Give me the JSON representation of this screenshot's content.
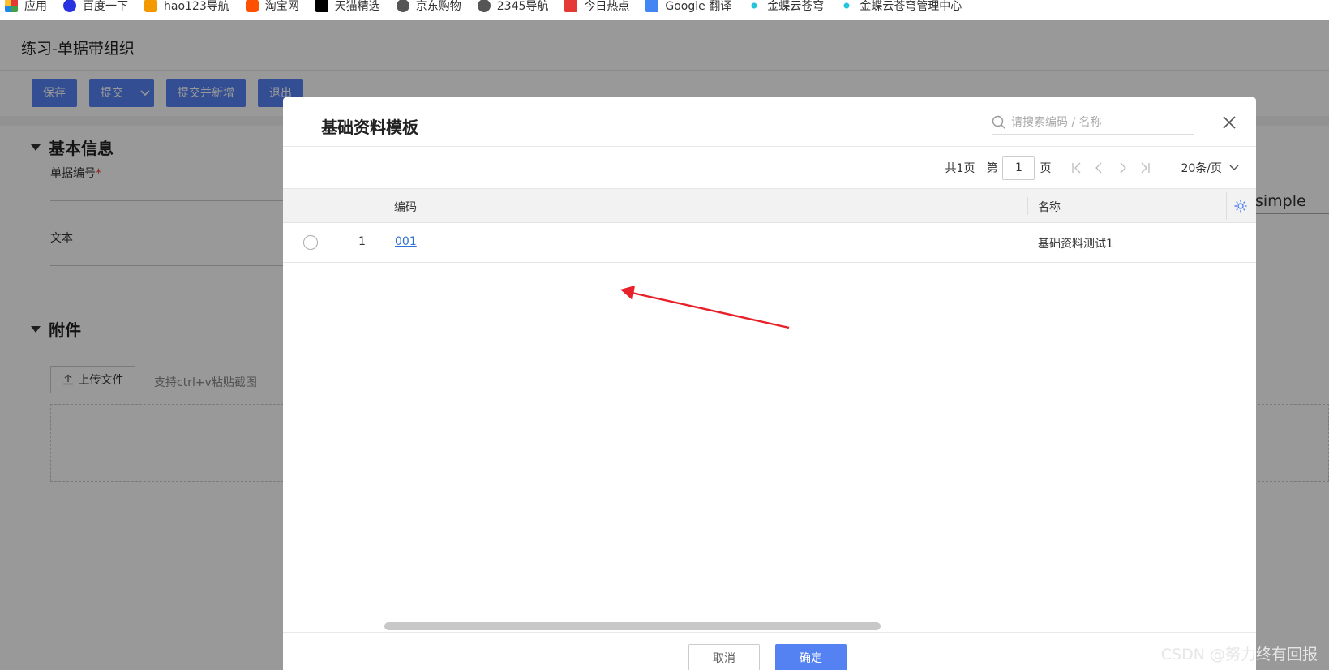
{
  "bookmarks": [
    {
      "label": "应用",
      "icon": "apps-icon"
    },
    {
      "label": "百度一下",
      "icon": "baidu-icon"
    },
    {
      "label": "hao123导航",
      "icon": "hao123-icon"
    },
    {
      "label": "淘宝网",
      "icon": "taobao-icon"
    },
    {
      "label": "天猫精选",
      "icon": "tmall-icon"
    },
    {
      "label": "京东购物",
      "icon": "globe-icon"
    },
    {
      "label": "2345导航",
      "icon": "globe-icon"
    },
    {
      "label": "今日热点",
      "icon": "toutiao-icon"
    },
    {
      "label": "Google 翻译",
      "icon": "google-translate-icon"
    },
    {
      "label": "金蝶云苍穹",
      "icon": "kingdee-icon"
    },
    {
      "label": "金蝶云苍穹管理中心",
      "icon": "kingdee-icon"
    }
  ],
  "app": {
    "title": "练习-单据带组织",
    "toolbar": {
      "save": "保存",
      "submit": "提交",
      "submit_new": "提交并新增",
      "exit": "退出"
    },
    "sections": {
      "basic_info": "基本信息",
      "attachment": "附件"
    },
    "fields": {
      "bill_no": "单据编号",
      "required_mark": "*",
      "text": "文本"
    },
    "upload": {
      "button": "上传文件",
      "hint": "支持ctrl+v粘贴截图"
    },
    "side_text": "simple"
  },
  "modal": {
    "title": "基础资料模板",
    "search_placeholder": "请搜索编码 / 名称",
    "pager": {
      "total": "共1页",
      "page_prefix": "第",
      "page_value": "1",
      "page_suffix": "页",
      "page_size": "20条/页"
    },
    "columns": {
      "code": "编码",
      "name": "名称"
    },
    "rows": [
      {
        "index": "1",
        "code": "001",
        "name": "基础资料测试1"
      }
    ],
    "cancel": "取消",
    "confirm": "确定"
  },
  "colors": {
    "primary": "#5582f3",
    "link": "#2c6fd1",
    "annotation_arrow": "#e8202a"
  },
  "watermark": "CSDN @努力终有回报"
}
